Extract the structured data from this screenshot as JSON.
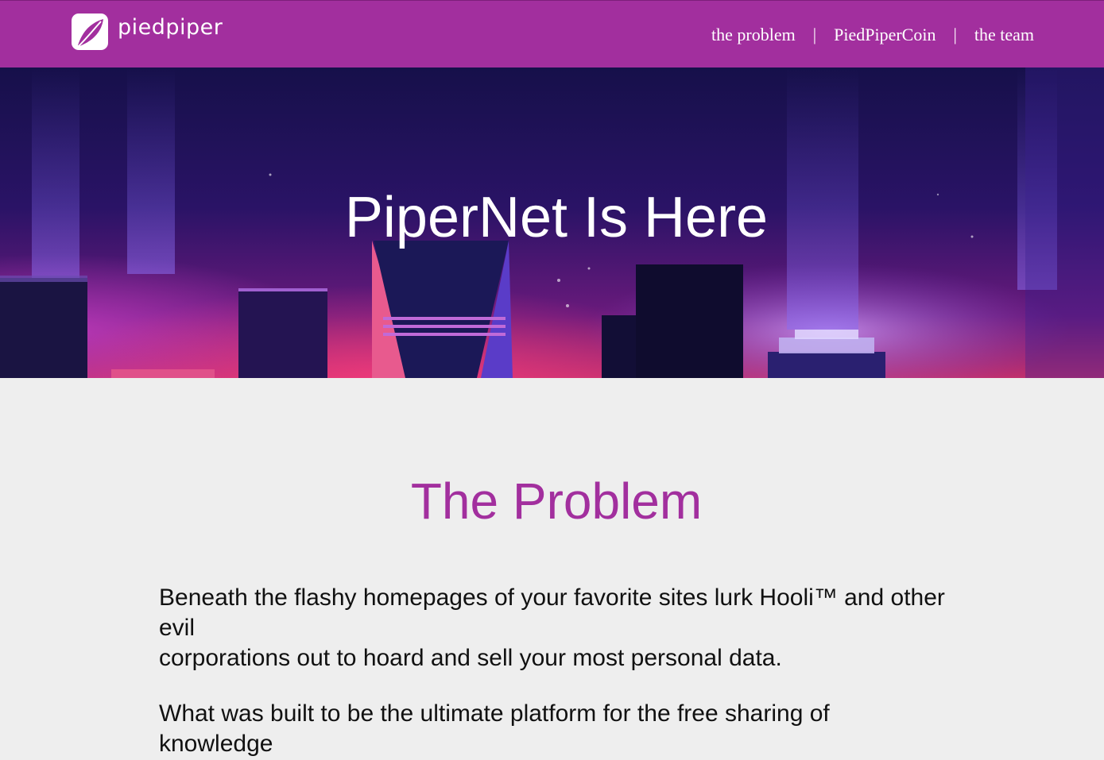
{
  "brand": {
    "name": "piedpiper"
  },
  "nav": {
    "items": [
      {
        "label": "the problem"
      },
      {
        "label": "PiedPiperCoin"
      },
      {
        "label": "the team"
      }
    ],
    "separator": "|"
  },
  "hero": {
    "title": "PiperNet Is Here"
  },
  "problem": {
    "title": "The Problem",
    "paragraph1_line1": "Beneath the flashy homepages of your favorite sites lurk Hooli™ and other evil",
    "paragraph1_line2": "corporations out to hoard and sell your most personal data.",
    "paragraph2_line1": "What was built to be the ultimate platform for the free sharing of knowledge"
  },
  "colors": {
    "brand_purple": "#a22f9e",
    "page_background": "#eeeeee"
  },
  "icons": {
    "logo": "piedpiper-leaf-icon"
  }
}
